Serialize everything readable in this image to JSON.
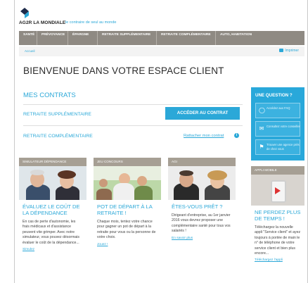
{
  "header": {
    "logo_text": "AG2R LA MONDIALE",
    "tagline": "le contraire de seul au monde"
  },
  "nav": {
    "items": [
      "SANTÉ",
      "PRÉVOYANCE",
      "ÉPARGNE",
      "RETRAITE SUPPLÉMENTAIRE",
      "RETRAITE COMPLÉMENTAIRE",
      "AUTO, HABITATION"
    ]
  },
  "breadcrumb": {
    "link": "Accueil",
    "print_label": "Imprimer"
  },
  "page_title": "BIENVENUE DANS VOTRE ESPACE CLIENT",
  "contracts": {
    "title": "MES CONTRATS",
    "supplementary_label": "RETRAITE SUPPLÉMENTAIRE",
    "access_button": "ACCÉDER AU CONTRAT",
    "complementary_label": "RETRAITE COMPLÉMENTAIRE",
    "attach_link": "Rattacher mon contrat"
  },
  "question": {
    "title": "UNE QUESTION ?",
    "items": [
      {
        "label": "Accédez aux FAQ",
        "icon": "lightbulb-icon"
      },
      {
        "label": "Consultez votre conseiller",
        "icon": "chat-icon"
      },
      {
        "label": "Trouver une agence près de chez vous",
        "icon": "location-pin-icon"
      }
    ]
  },
  "cards": [
    {
      "head": "SIMULATEUR DÉPENDANCE",
      "title": "ÉVALUEZ LE COÛT DE LA DÉPENDANCE",
      "text": "En cas de perte d'autonomie, les frais médicaux et d'assistance peuvent vite grimper. Avec notre simulateur, vous pouvez désormais évaluer le coût de la dépendance...",
      "link": "Simulez"
    },
    {
      "head": "JEU CONCOURS",
      "title": "POT DE DÉPART À LA RETRAITE !",
      "text": "Chaque mois, tentez votre chance pour gagner un pot de départ à la retraite pour vous ou la personne de votre choix.",
      "link": "Jouez !"
    },
    {
      "head": "AGI",
      "title": "ÊTES-VOUS PRÊT ?",
      "text": "Dirigeant d'entreprise, au 1er janvier 2016 vous devrez proposer une complémentaire santé pour tous vos salariés !",
      "link": "En savoir plus"
    }
  ],
  "mobile": {
    "head": "APPLI MOBILE",
    "title": "NE PERDEZ PLUS DE TEMPS !",
    "text": "Téléchargez la nouvelle appli \"Service client\" et ayez toujours à portée de main le n° de téléphone de votre service client et bien plus encore...",
    "link": "Téléchargez l'appli"
  },
  "colors": {
    "accent": "#2ba8d8",
    "nav_bg": "#8f8a83",
    "card_head_bg": "#a69f94",
    "question_bg": "#29a8da"
  }
}
